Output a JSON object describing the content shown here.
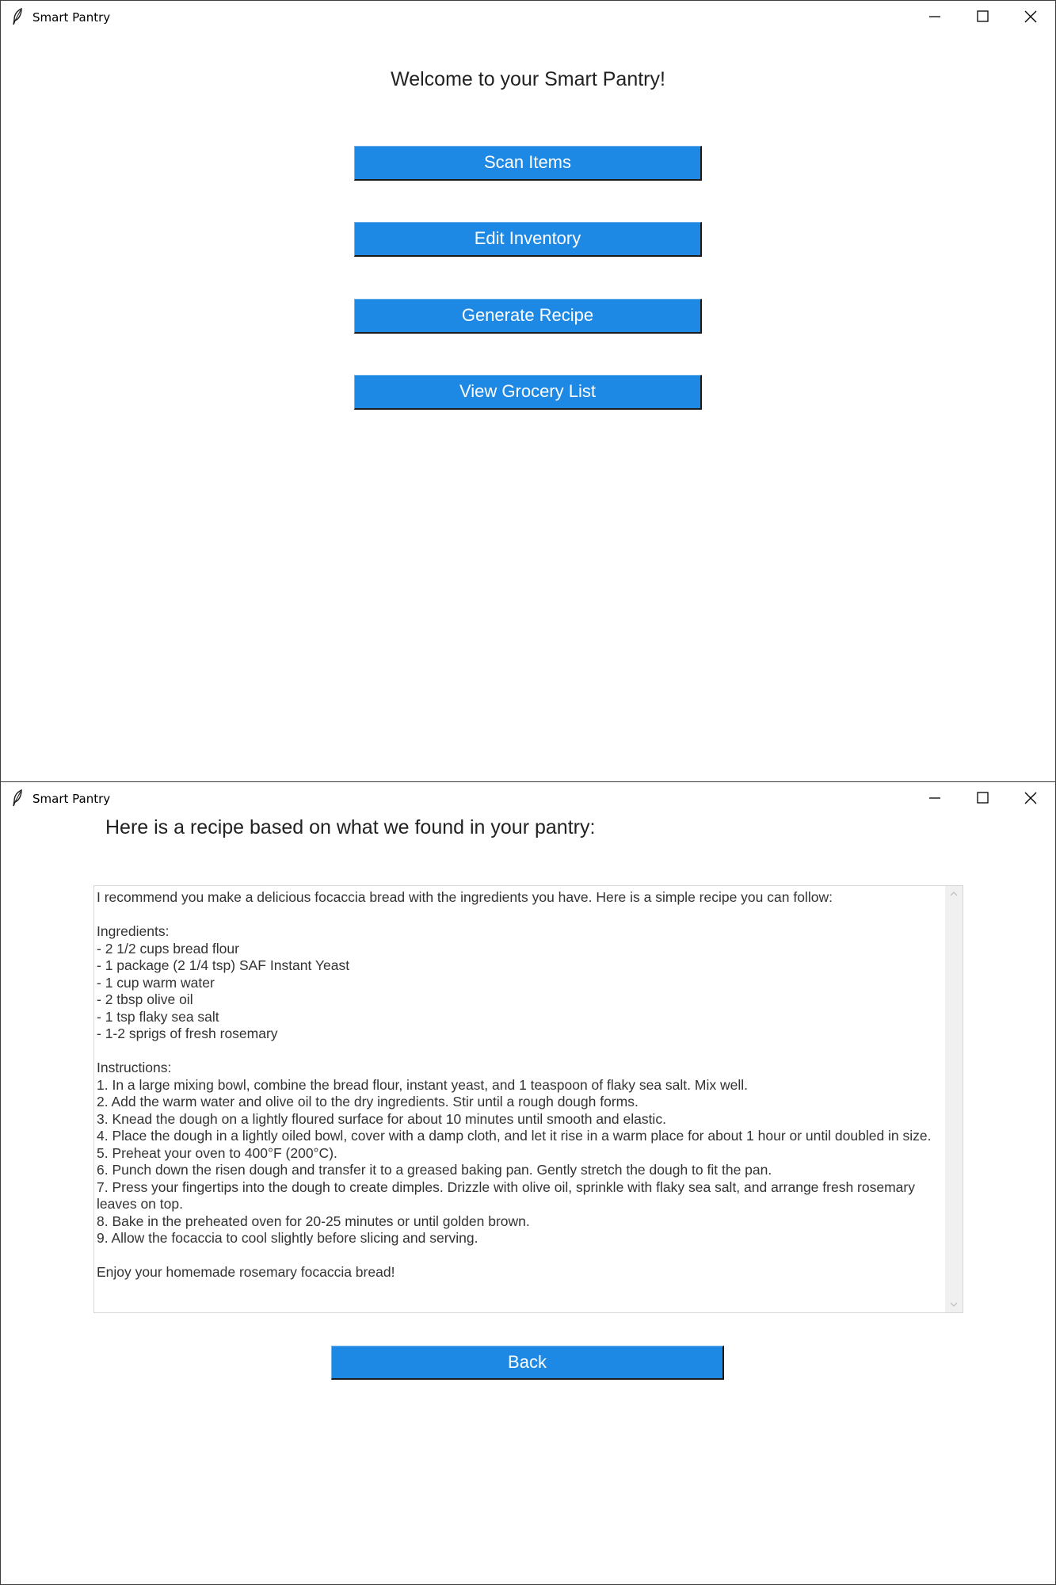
{
  "window_top": {
    "title": "Smart Pantry",
    "welcome_text": "Welcome to your Smart Pantry!",
    "buttons": {
      "scan": "Scan Items",
      "edit": "Edit Inventory",
      "recipe": "Generate Recipe",
      "grocery": "View Grocery List"
    }
  },
  "window_bottom": {
    "title": "Smart Pantry",
    "heading": "Here is a recipe based on what we found in your pantry:",
    "recipe_text": "I recommend you make a delicious focaccia bread with the ingredients you have. Here is a simple recipe you can follow:\n\nIngredients:\n- 2 1/2 cups bread flour\n- 1 package (2 1/4 tsp) SAF Instant Yeast\n- 1 cup warm water\n- 2 tbsp olive oil\n- 1 tsp flaky sea salt\n- 1-2 sprigs of fresh rosemary\n\nInstructions:\n1. In a large mixing bowl, combine the bread flour, instant yeast, and 1 teaspoon of flaky sea salt. Mix well.\n2. Add the warm water and olive oil to the dry ingredients. Stir until a rough dough forms.\n3. Knead the dough on a lightly floured surface for about 10 minutes until smooth and elastic.\n4. Place the dough in a lightly oiled bowl, cover with a damp cloth, and let it rise in a warm place for about 1 hour or until doubled in size.\n5. Preheat your oven to 400°F (200°C).\n6. Punch down the risen dough and transfer it to a greased baking pan. Gently stretch the dough to fit the pan.\n7. Press your fingertips into the dough to create dimples. Drizzle with olive oil, sprinkle with flaky sea salt, and arrange fresh rosemary leaves on top.\n8. Bake in the preheated oven for 20-25 minutes or until golden brown.\n9. Allow the focaccia to cool slightly before slicing and serving.\n\nEnjoy your homemade rosemary focaccia bread!",
    "back_label": "Back"
  },
  "icons": {
    "app": "feather-icon",
    "minimize": "minimize-icon",
    "maximize": "maximize-icon",
    "close": "close-icon",
    "scroll_up": "chevron-up-icon",
    "scroll_down": "chevron-down-icon"
  },
  "colors": {
    "button_bg": "#1e88e5",
    "button_text": "#ffffff",
    "heading_text": "#222222",
    "body_text": "#333333"
  }
}
